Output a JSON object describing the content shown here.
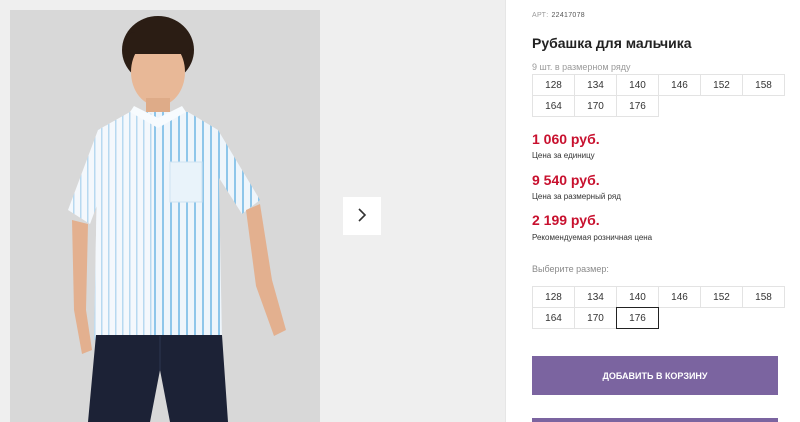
{
  "product": {
    "art_label": "АРТ:",
    "art_number": "22417078",
    "title": "Рубашка для мальчика"
  },
  "row_info": {
    "note": "9 шт. в размерном ряду",
    "sizes": [
      "128",
      "134",
      "140",
      "146",
      "152",
      "158",
      "164",
      "170",
      "176"
    ]
  },
  "prices": [
    {
      "value": "1 060 руб.",
      "label": "Цена за единицу"
    },
    {
      "value": "9 540 руб.",
      "label": "Цена за размерный ряд"
    },
    {
      "value": "2 199 руб.",
      "label": "Рекомендуемая розничная цена"
    }
  ],
  "size_select": {
    "label": "Выберите размер:",
    "sizes": [
      "128",
      "134",
      "140",
      "146",
      "152",
      "158",
      "164",
      "170",
      "176"
    ],
    "selected": "176"
  },
  "actions": {
    "add_to_cart": "Добавить в корзину"
  },
  "colors": {
    "accent": "#7b64a0",
    "price": "#c8102e"
  },
  "icons": {
    "next": "chevron-right-icon"
  }
}
